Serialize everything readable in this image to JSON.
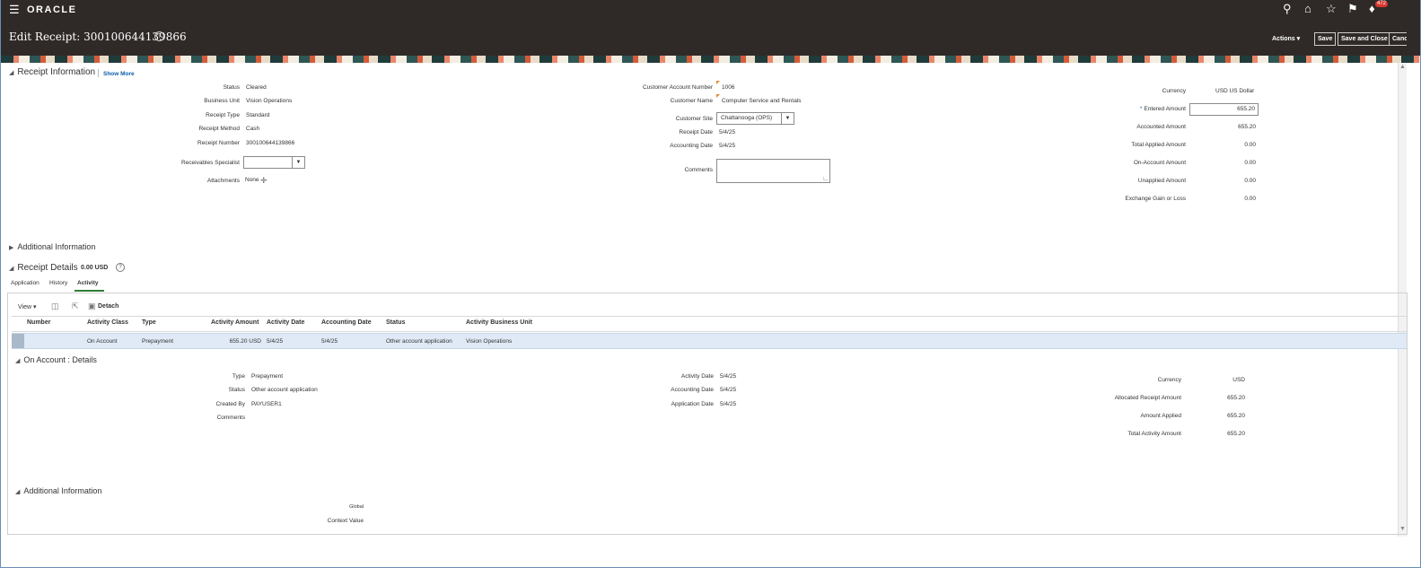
{
  "topbar": {
    "menu_icon": "hamburger-menu-icon",
    "logo": "ORACLE",
    "icons": [
      "search-icon",
      "home-icon",
      "star-icon",
      "flag-icon",
      "bell-icon"
    ],
    "notification_count": "472"
  },
  "titlebar": {
    "title": "Edit Receipt: 300100644139866",
    "help": "?",
    "actions_label": "Actions",
    "save_label": "Save",
    "save_close_label": "Save and Close",
    "cancel_label": "Cancel"
  },
  "receipt_info": {
    "heading": "Receipt Information",
    "show_more": "Show More",
    "left": {
      "status_label": "Status",
      "status": "Cleared",
      "bu_label": "Business Unit",
      "bu": "Vision Operations",
      "type_label": "Receipt Type",
      "type": "Standard",
      "method_label": "Receipt Method",
      "method": "Cash",
      "number_label": "Receipt Number",
      "number": "300100644139866",
      "specialist_label": "Receivables Specialist",
      "specialist": "",
      "attachments_label": "Attachments",
      "attachments": "None"
    },
    "middle": {
      "acct_num_label": "Customer Account Number",
      "acct_num": "1006",
      "cust_name_label": "Customer Name",
      "cust_name": "Computer Service and Rentals",
      "site_label": "Customer Site",
      "site": "Chattanooga (OPS)",
      "receipt_date_label": "Receipt Date",
      "receipt_date": "5/4/25",
      "acct_date_label": "Accounting Date",
      "acct_date": "5/4/25",
      "comments_label": "Comments",
      "comments": ""
    },
    "right": {
      "currency_label": "Currency",
      "currency": "USD US Dollar",
      "entered_label": "Entered Amount",
      "entered": "655.20",
      "accounted_label": "Accounted Amount",
      "accounted": "655.20",
      "applied_label": "Total Applied Amount",
      "applied": "0.00",
      "onaccount_label": "On-Account Amount",
      "onaccount": "0.00",
      "unapplied_label": "Unapplied Amount",
      "unapplied": "0.00",
      "exchange_label": "Exchange Gain or Loss",
      "exchange": "0.00"
    }
  },
  "additional_info_heading": "Additional Information",
  "receipt_details": {
    "heading": "Receipt Details",
    "amount": "0.00 USD",
    "help": "?",
    "tabs": [
      "Application",
      "History",
      "Activity"
    ],
    "toolbar": {
      "view": "View",
      "detach": "Detach"
    },
    "columns": [
      "Number",
      "Activity Class",
      "Type",
      "Activity Amount",
      "Activity Date",
      "Accounting Date",
      "Status",
      "Activity Business Unit"
    ],
    "rows": [
      {
        "number": "",
        "activity_class": "On Account",
        "type": "Prepayment",
        "amount": "655.20 USD",
        "activity_date": "5/4/25",
        "accounting_date": "5/4/25",
        "status": "Other account application",
        "bu": "Vision Operations"
      }
    ]
  },
  "on_account": {
    "heading": "On Account : Details",
    "type_label": "Type",
    "type": "Prepayment",
    "status_label": "Status",
    "status": "Other account application",
    "created_label": "Created By",
    "created": "PAYUSER1",
    "comments_label": "Comments",
    "activity_date_label": "Activity Date",
    "activity_date": "5/4/25",
    "accounting_date_label": "Accounting Date",
    "accounting_date": "5/4/25",
    "application_date_label": "Application Date",
    "application_date": "5/4/25",
    "currency_label": "Currency",
    "currency": "USD",
    "allocated_label": "Allocated Receipt Amount",
    "allocated": "655.20",
    "applied_label": "Amount Applied",
    "applied": "655.20",
    "total_label": "Total Activity Amount",
    "total": "655.20"
  },
  "additional_info2": {
    "heading": "Additional Information",
    "global_label": "Global",
    "context_label": "Context Value"
  }
}
